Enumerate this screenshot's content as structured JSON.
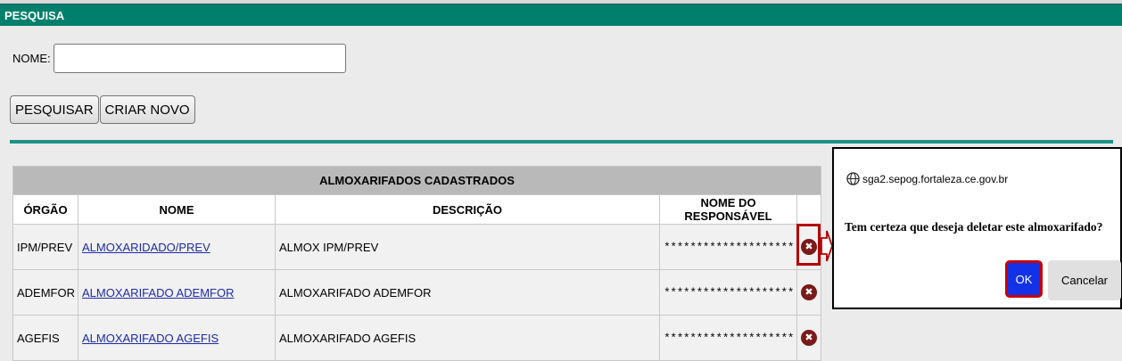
{
  "header": {
    "title": "PESQUISA"
  },
  "search": {
    "name_label": "NOME:",
    "name_value": "",
    "name_placeholder": ""
  },
  "buttons": {
    "search_label": "PESQUISAR",
    "create_label": "CRIAR NOVO"
  },
  "table": {
    "caption": "ALMOXARIFADOS CADASTRADOS",
    "columns": [
      "ÓRGÃO",
      "NOME",
      "DESCRIÇÃO",
      "NOME DO RESPONSÁVEL",
      ""
    ],
    "rows": [
      {
        "orgao": "IPM/PREV",
        "nome": "ALMOXARIDADO/PREV",
        "descricao": "ALMOX IPM/PREV",
        "responsavel": "********************",
        "delete_icon": "delete-circle-x-icon"
      },
      {
        "orgao": "ADEMFOR",
        "nome": "ALMOXARIFADO ADEMFOR",
        "descricao": "ALMOXARIFADO ADEMFOR",
        "responsavel": "********************",
        "delete_icon": "delete-circle-x-icon"
      },
      {
        "orgao": "AGEFIS",
        "nome": "ALMOXARIFADO AGEFIS",
        "descricao": "ALMOXARIFADO AGEFIS",
        "responsavel": "********************",
        "delete_icon": "delete-circle-x-icon"
      }
    ]
  },
  "dialog": {
    "origin": "sga2.sepog.fortaleza.ce.gov.br",
    "message": "Tem certeza que deseja deletar este almoxarifado?",
    "ok_label": "OK",
    "cancel_label": "Cancelar"
  },
  "icons": {
    "delete": "✖",
    "globe": "globe-icon",
    "arrow": "arrow-right-icon"
  },
  "colors": {
    "header_bg": "#00806c",
    "divider": "#1c9188",
    "link": "#1d2ca8",
    "delete_icon": "#7a1a1a",
    "highlight": "#b30000",
    "ok_button": "#1332e8"
  }
}
